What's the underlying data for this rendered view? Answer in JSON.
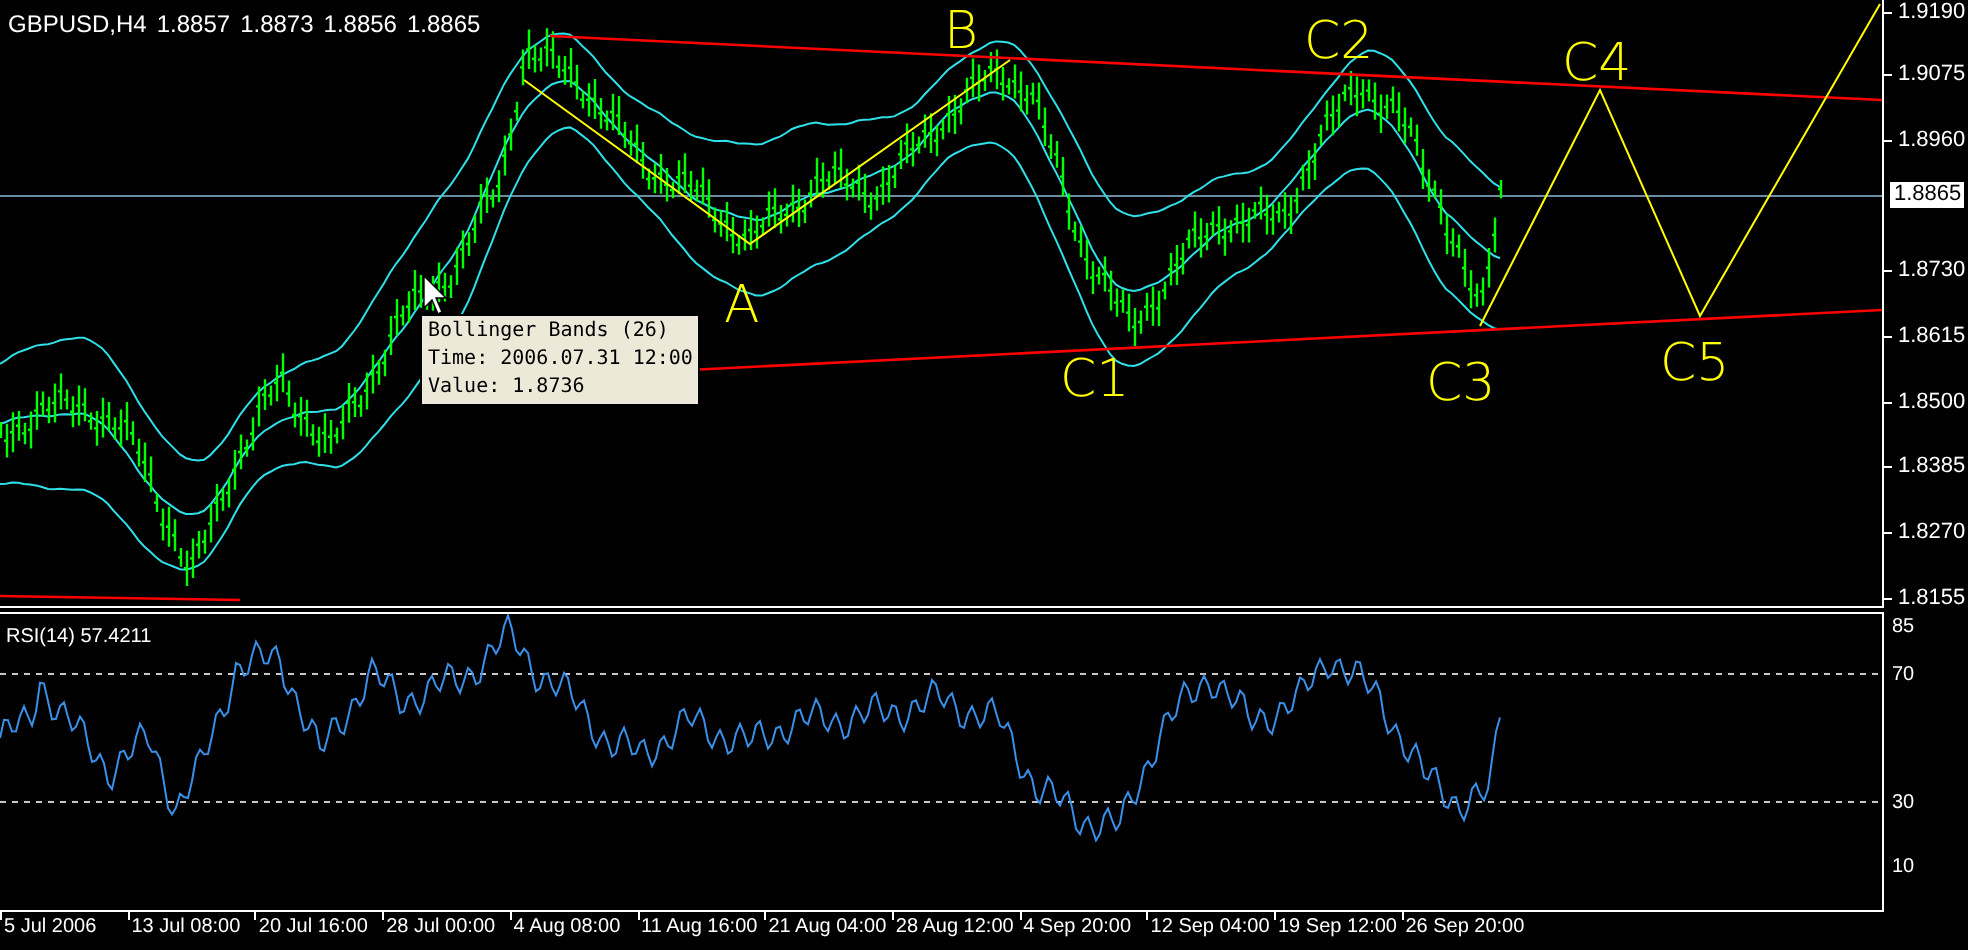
{
  "symbol_header": {
    "symbol": "GBPUSD,H4",
    "open": "1.8857",
    "high": "1.8873",
    "low": "1.8856",
    "close": "1.8865"
  },
  "price_axis": {
    "ticks": [
      "1.9190",
      "1.9075",
      "1.8960",
      "1.8730",
      "1.8615",
      "1.8500",
      "1.8385",
      "1.8270",
      "1.8155"
    ],
    "current_price": "1.8865"
  },
  "annotations": [
    "A",
    "B",
    "C1",
    "C2",
    "C3",
    "C4",
    "C5"
  ],
  "tooltip": {
    "title": "Bollinger Bands (26)",
    "time": "Time: 2006.07.31 12:00",
    "value": "Value: 1.8736"
  },
  "rsi": {
    "label": "RSI(14) 57.4211",
    "ticks": [
      "85",
      "70",
      "30",
      "10"
    ]
  },
  "time_axis": [
    "5 Jul 2006",
    "13 Jul 08:00",
    "20 Jul 16:00",
    "28 Jul 00:00",
    "4 Aug 08:00",
    "11 Aug 16:00",
    "21 Aug 04:00",
    "28 Aug 12:00",
    "4 Sep 20:00",
    "12 Sep 04:00",
    "19 Sep 12:00",
    "26 Sep 20:00"
  ]
}
